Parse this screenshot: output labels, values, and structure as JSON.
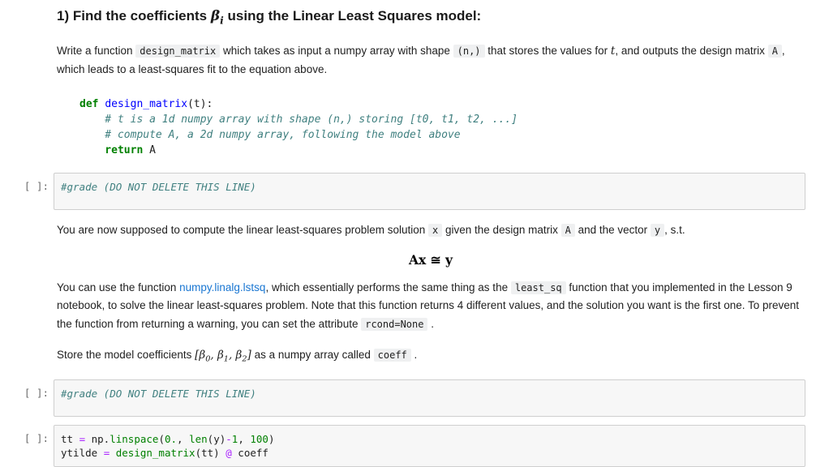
{
  "heading": {
    "pre": "1) Find the coefficients ",
    "beta": "β",
    "beta_sub": "i",
    "post": " using the Linear Least Squares model:"
  },
  "para1": {
    "t1": "Write a function ",
    "c1": "design_matrix",
    "t2": " which takes as input a numpy array with shape ",
    "c2": "(n,)",
    "t3": " that stores the values for ",
    "em1": "t",
    "t4": ", and outputs the design matrix ",
    "c3": "A",
    "t5": ", which leads to a least-squares fit to the equation above."
  },
  "defblock": {
    "l1_kw": "def ",
    "l1_fn": "design_matrix",
    "l1_rest": "(t):",
    "l2": "    # t is a 1d numpy array with shape (n,) storing [t0, t1, t2, ...]",
    "l3": "    # compute A, a 2d numpy array, following the model above",
    "l4_kw": "    return",
    "l4_rest": " A"
  },
  "cells": {
    "prompt": "[ ]:",
    "grade_comment": "#grade (DO NOT DELETE THIS LINE)"
  },
  "para2": {
    "t1": "You are now supposed to compute the linear least-squares problem solution ",
    "c1": "x",
    "t2": " given the design matrix ",
    "c2": "A",
    "t3": " and the vector ",
    "c3": "y",
    "t4": ", s.t."
  },
  "math_display": "Ax ≅ y",
  "para3": {
    "t1": "You can use the function ",
    "link": "numpy.linalg.lstsq",
    "t2": ", which essentially performs the same thing as the ",
    "c1": "least_sq",
    "t3": " function that you implemented in the Lesson 9 notebook, to solve the linear least-squares problem. Note that this function returns 4 different values, and the solution you want is the first one. To prevent the function from returning a warning, you can set the attribute ",
    "c2": "rcond=None",
    "t4": " ."
  },
  "para4": {
    "t1": "Store the model coefficients ",
    "m_open": "[β",
    "s0": "0",
    "m_mid1": ", β",
    "s1": "1",
    "m_mid2": ", β",
    "s2": "2",
    "m_close": "]",
    "t2": " as a numpy array called ",
    "c1": "coeff",
    "t3": " ."
  },
  "cell3": {
    "l1_n1": "tt ",
    "l1_o1": "=",
    "l1_n2": " np.",
    "l1_g1": "linspace",
    "l1_n3": "(",
    "l1_m1": "0.",
    "l1_n4": ", ",
    "l1_b1": "len",
    "l1_n5": "(y)",
    "l1_o2": "-",
    "l1_m2": "1",
    "l1_n6": ", ",
    "l1_m3": "100",
    "l1_n7": ")",
    "l2_n1": "ytilde ",
    "l2_o1": "=",
    "l2_n2": " ",
    "l2_g1": "design_matrix",
    "l2_n3": "(tt) ",
    "l2_o2": "@",
    "l2_n4": " coeff"
  }
}
